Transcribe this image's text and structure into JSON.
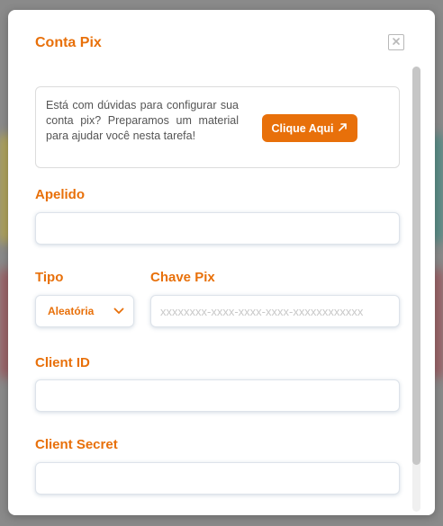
{
  "modal": {
    "title": "Conta Pix",
    "close_icon": "close-icon"
  },
  "info": {
    "text": "Está com dúvidas para configurar sua conta pix? Preparamos um material para ajudar você nesta tarefa!",
    "button_label": "Clique Aqui",
    "button_icon": "external-link-arrow-icon"
  },
  "form": {
    "apelido": {
      "label": "Apelido",
      "value": "",
      "placeholder": ""
    },
    "tipo": {
      "label": "Tipo",
      "selected": "Aleatória",
      "icon": "chevron-down-icon"
    },
    "chave_pix": {
      "label": "Chave Pix",
      "value": "",
      "placeholder": "xxxxxxxx-xxxx-xxxx-xxxx-xxxxxxxxxxxx"
    },
    "client_id": {
      "label": "Client ID",
      "value": "",
      "placeholder": ""
    },
    "client_secret": {
      "label": "Client Secret",
      "value": "",
      "placeholder": ""
    }
  },
  "colors": {
    "accent": "#e8700a",
    "field_border": "#dde3ea",
    "placeholder": "#c8c8c8"
  }
}
